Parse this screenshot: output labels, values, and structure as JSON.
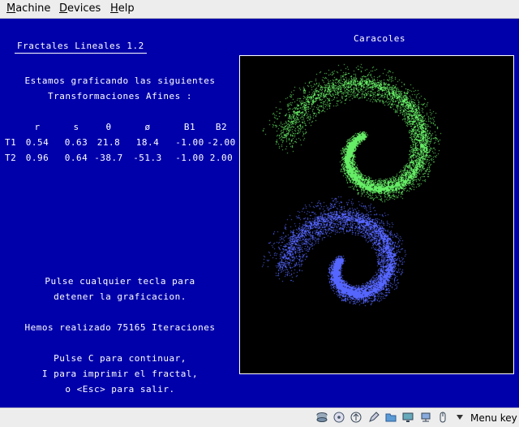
{
  "menubar": {
    "items": [
      {
        "label": "Machine",
        "accel": "M"
      },
      {
        "label": "Devices",
        "accel": "D"
      },
      {
        "label": "Help",
        "accel": "H"
      }
    ]
  },
  "program": {
    "title": "Fractales Lineales 1.2",
    "intro_line1": "Estamos graficando las siguientes",
    "intro_line2": "Transformaciones Afines :",
    "table": {
      "headers": [
        "r",
        "s",
        "θ",
        "ø",
        "B1",
        "B2"
      ],
      "rows": [
        {
          "label": "T1",
          "values": [
            "0.54",
            "0.63",
            "21.8",
            "18.4",
            "-1.00",
            "-2.00"
          ]
        },
        {
          "label": "T2",
          "values": [
            "0.96",
            "0.64",
            "-38.7",
            "-51.3",
            "-1.00",
            "2.00"
          ]
        }
      ]
    },
    "stop_line1": "Pulse cualquier tecla para",
    "stop_line2": "detener la graficacion.",
    "iterations_line": "Hemos realizado 75165 Iteraciones",
    "continue_line1": "Pulse C para continuar,",
    "continue_line2": "I para imprimir el fractal,",
    "continue_line3": "o <Esc> para salir.",
    "fractal_title": "Caracoles"
  },
  "colors": {
    "screen_bg": "#0000aa",
    "text": "#ffffff",
    "fractal_green": "#66ee66",
    "fractal_blue": "#5566ff"
  },
  "statusbar": {
    "icons": [
      "hard-disk-icon",
      "optical-drive-icon",
      "usb-icon",
      "pencil-icon",
      "folder-icon",
      "display-icon",
      "network-icon",
      "mouse-icon",
      "arrow-down-icon"
    ],
    "host_key_label": "Menu key"
  }
}
